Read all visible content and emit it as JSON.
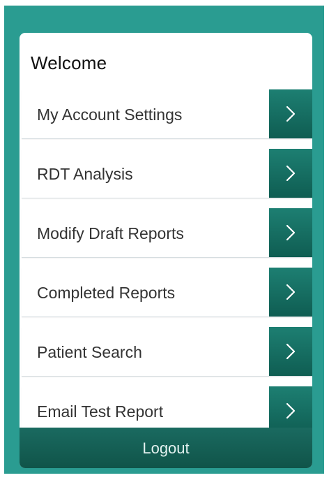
{
  "welcome": "Welcome",
  "menu": {
    "items": [
      {
        "label": "My Account Settings"
      },
      {
        "label": "RDT Analysis"
      },
      {
        "label": "Modify Draft Reports"
      },
      {
        "label": "Completed Reports"
      },
      {
        "label": "Patient Search"
      },
      {
        "label": "Email Test Report"
      }
    ]
  },
  "logout_label": "Logout",
  "colors": {
    "frame": "#2a9c91",
    "arrow_tile": "#16705f",
    "logout_bar": "#155f55"
  },
  "icons": {
    "arrow": "chevron-right-icon"
  }
}
